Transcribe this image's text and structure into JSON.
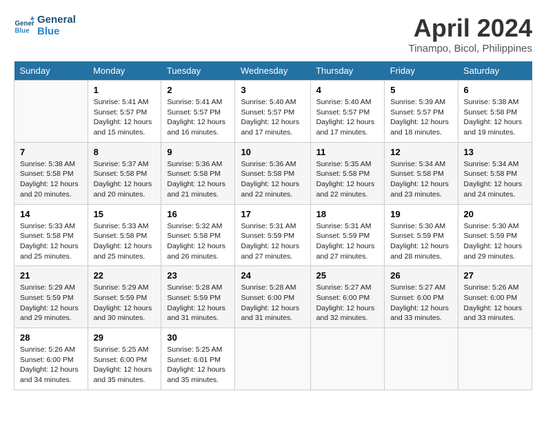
{
  "header": {
    "logo_line1": "General",
    "logo_line2": "Blue",
    "month_title": "April 2024",
    "location": "Tinampo, Bicol, Philippines"
  },
  "weekdays": [
    "Sunday",
    "Monday",
    "Tuesday",
    "Wednesday",
    "Thursday",
    "Friday",
    "Saturday"
  ],
  "weeks": [
    [
      {
        "num": "",
        "info": ""
      },
      {
        "num": "1",
        "info": "Sunrise: 5:41 AM\nSunset: 5:57 PM\nDaylight: 12 hours\nand 15 minutes."
      },
      {
        "num": "2",
        "info": "Sunrise: 5:41 AM\nSunset: 5:57 PM\nDaylight: 12 hours\nand 16 minutes."
      },
      {
        "num": "3",
        "info": "Sunrise: 5:40 AM\nSunset: 5:57 PM\nDaylight: 12 hours\nand 17 minutes."
      },
      {
        "num": "4",
        "info": "Sunrise: 5:40 AM\nSunset: 5:57 PM\nDaylight: 12 hours\nand 17 minutes."
      },
      {
        "num": "5",
        "info": "Sunrise: 5:39 AM\nSunset: 5:57 PM\nDaylight: 12 hours\nand 18 minutes."
      },
      {
        "num": "6",
        "info": "Sunrise: 5:38 AM\nSunset: 5:58 PM\nDaylight: 12 hours\nand 19 minutes."
      }
    ],
    [
      {
        "num": "7",
        "info": "Sunrise: 5:38 AM\nSunset: 5:58 PM\nDaylight: 12 hours\nand 20 minutes."
      },
      {
        "num": "8",
        "info": "Sunrise: 5:37 AM\nSunset: 5:58 PM\nDaylight: 12 hours\nand 20 minutes."
      },
      {
        "num": "9",
        "info": "Sunrise: 5:36 AM\nSunset: 5:58 PM\nDaylight: 12 hours\nand 21 minutes."
      },
      {
        "num": "10",
        "info": "Sunrise: 5:36 AM\nSunset: 5:58 PM\nDaylight: 12 hours\nand 22 minutes."
      },
      {
        "num": "11",
        "info": "Sunrise: 5:35 AM\nSunset: 5:58 PM\nDaylight: 12 hours\nand 22 minutes."
      },
      {
        "num": "12",
        "info": "Sunrise: 5:34 AM\nSunset: 5:58 PM\nDaylight: 12 hours\nand 23 minutes."
      },
      {
        "num": "13",
        "info": "Sunrise: 5:34 AM\nSunset: 5:58 PM\nDaylight: 12 hours\nand 24 minutes."
      }
    ],
    [
      {
        "num": "14",
        "info": "Sunrise: 5:33 AM\nSunset: 5:58 PM\nDaylight: 12 hours\nand 25 minutes."
      },
      {
        "num": "15",
        "info": "Sunrise: 5:33 AM\nSunset: 5:58 PM\nDaylight: 12 hours\nand 25 minutes."
      },
      {
        "num": "16",
        "info": "Sunrise: 5:32 AM\nSunset: 5:58 PM\nDaylight: 12 hours\nand 26 minutes."
      },
      {
        "num": "17",
        "info": "Sunrise: 5:31 AM\nSunset: 5:59 PM\nDaylight: 12 hours\nand 27 minutes."
      },
      {
        "num": "18",
        "info": "Sunrise: 5:31 AM\nSunset: 5:59 PM\nDaylight: 12 hours\nand 27 minutes."
      },
      {
        "num": "19",
        "info": "Sunrise: 5:30 AM\nSunset: 5:59 PM\nDaylight: 12 hours\nand 28 minutes."
      },
      {
        "num": "20",
        "info": "Sunrise: 5:30 AM\nSunset: 5:59 PM\nDaylight: 12 hours\nand 29 minutes."
      }
    ],
    [
      {
        "num": "21",
        "info": "Sunrise: 5:29 AM\nSunset: 5:59 PM\nDaylight: 12 hours\nand 29 minutes."
      },
      {
        "num": "22",
        "info": "Sunrise: 5:29 AM\nSunset: 5:59 PM\nDaylight: 12 hours\nand 30 minutes."
      },
      {
        "num": "23",
        "info": "Sunrise: 5:28 AM\nSunset: 5:59 PM\nDaylight: 12 hours\nand 31 minutes."
      },
      {
        "num": "24",
        "info": "Sunrise: 5:28 AM\nSunset: 6:00 PM\nDaylight: 12 hours\nand 31 minutes."
      },
      {
        "num": "25",
        "info": "Sunrise: 5:27 AM\nSunset: 6:00 PM\nDaylight: 12 hours\nand 32 minutes."
      },
      {
        "num": "26",
        "info": "Sunrise: 5:27 AM\nSunset: 6:00 PM\nDaylight: 12 hours\nand 33 minutes."
      },
      {
        "num": "27",
        "info": "Sunrise: 5:26 AM\nSunset: 6:00 PM\nDaylight: 12 hours\nand 33 minutes."
      }
    ],
    [
      {
        "num": "28",
        "info": "Sunrise: 5:26 AM\nSunset: 6:00 PM\nDaylight: 12 hours\nand 34 minutes."
      },
      {
        "num": "29",
        "info": "Sunrise: 5:25 AM\nSunset: 6:00 PM\nDaylight: 12 hours\nand 35 minutes."
      },
      {
        "num": "30",
        "info": "Sunrise: 5:25 AM\nSunset: 6:01 PM\nDaylight: 12 hours\nand 35 minutes."
      },
      {
        "num": "",
        "info": ""
      },
      {
        "num": "",
        "info": ""
      },
      {
        "num": "",
        "info": ""
      },
      {
        "num": "",
        "info": ""
      }
    ]
  ]
}
